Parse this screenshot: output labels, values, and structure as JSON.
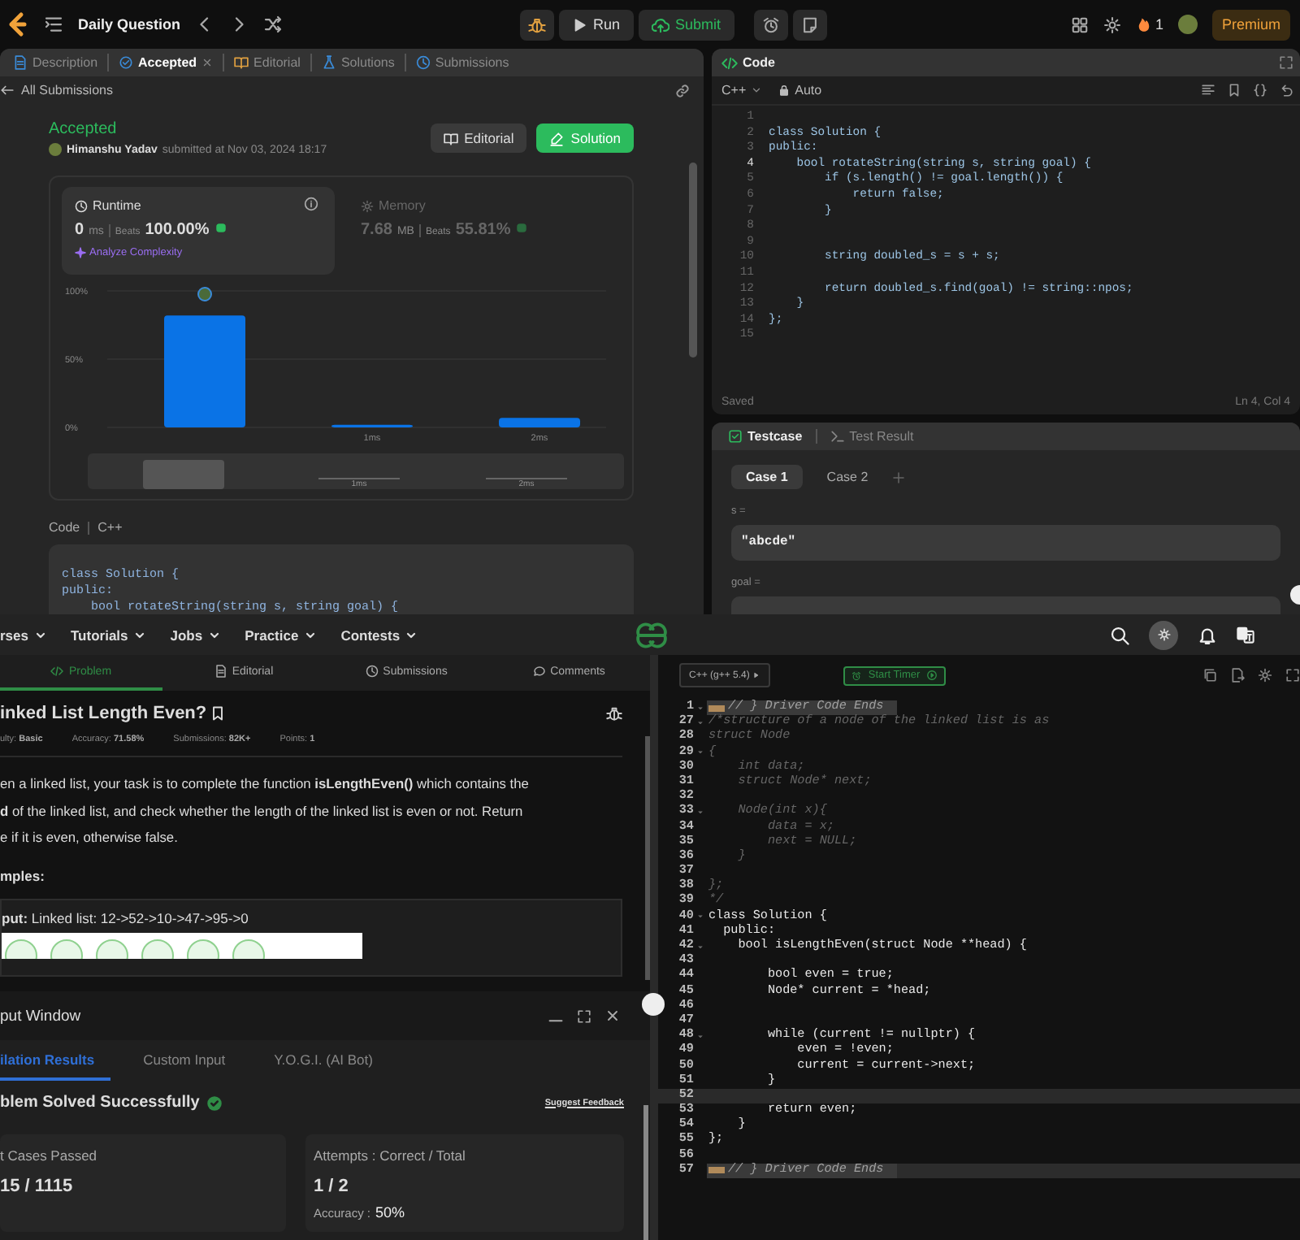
{
  "leetcode": {
    "topbar": {
      "title": "Daily Question",
      "run": "Run",
      "submit": "Submit",
      "streak": "1",
      "premium": "Premium"
    },
    "tabs": [
      {
        "label": "Description",
        "selected": false,
        "closable": false
      },
      {
        "label": "Accepted",
        "selected": true,
        "closable": true
      },
      {
        "label": "Editorial",
        "selected": false,
        "closable": false
      },
      {
        "label": "Solutions",
        "selected": false,
        "closable": false
      },
      {
        "label": "Submissions",
        "selected": false,
        "closable": false
      }
    ],
    "back_link": "All Submissions",
    "submission": {
      "status": "Accepted",
      "author": "Himanshu Yadav",
      "submitted": "submitted at Nov 03, 2024 18:17",
      "buttons": [
        {
          "label": "Editorial",
          "kind": "secondary"
        },
        {
          "label": "Solution",
          "kind": "primary"
        }
      ]
    },
    "stats": [
      {
        "title": "Runtime",
        "selected": true,
        "value": "0",
        "unit": "ms",
        "beats_label": "Beats",
        "beats": "100.00%",
        "link": "Analyze Complexity"
      },
      {
        "title": "Memory",
        "selected": false,
        "value": "7.68",
        "unit": "MB",
        "beats_label": "Beats",
        "beats": "55.81%"
      }
    ],
    "runtime_chart": {
      "chart_data": {
        "type": "bar",
        "categories": [
          null,
          "1ms",
          "2ms"
        ],
        "values": [
          82,
          2,
          7
        ],
        "ylim": [
          0,
          100
        ],
        "yticks": [
          {
            "value": 0,
            "label": "0%"
          },
          {
            "value": 50,
            "label": "50%"
          },
          {
            "value": 100,
            "label": "100%"
          }
        ]
      },
      "navigator_labels": [
        "1ms",
        "2ms"
      ]
    },
    "code_label": "Code",
    "code_language": "C++",
    "code_preview": [
      "class Solution {",
      "public:",
      "    bool rotateString(string s, string goal) {"
    ],
    "editor": {
      "title": "Code",
      "language": "C++",
      "mode": "Auto",
      "status": "Saved",
      "cursor": "Ln 4, Col 4",
      "lines": [
        {
          "number": "1",
          "current": false
        },
        {
          "number": "2",
          "code": "class Solution {",
          "current": false
        },
        {
          "number": "3",
          "code": "public:",
          "current": false
        },
        {
          "number": "4",
          "code": "    bool rotateString(string s, string goal) {",
          "current": true
        },
        {
          "number": "5",
          "code": "        if (s.length() != goal.length()) {",
          "current": false
        },
        {
          "number": "6",
          "code": "            return false;",
          "current": false
        },
        {
          "number": "7",
          "code": "        }",
          "current": false
        },
        {
          "number": "8",
          "current": false
        },
        {
          "number": "9",
          "current": false
        },
        {
          "number": "10",
          "code": "        string doubled_s = s + s;",
          "current": false
        },
        {
          "number": "11",
          "current": false
        },
        {
          "number": "12",
          "code": "        return doubled_s.find(goal) != string::npos;",
          "current": false
        },
        {
          "number": "13",
          "code": "    }",
          "current": false
        },
        {
          "number": "14",
          "code": "};",
          "current": false
        },
        {
          "number": "15",
          "current": false
        }
      ]
    },
    "testcase": {
      "tabs": [
        {
          "label": "Testcase",
          "selected": true
        },
        {
          "label": "Test Result",
          "selected": false
        }
      ],
      "cases": [
        {
          "label": "Case 1",
          "selected": true
        },
        {
          "label": "Case 2",
          "selected": false
        }
      ],
      "params": [
        {
          "name": "s =",
          "value": "\"abcde\""
        },
        {
          "name": "goal ="
        }
      ]
    }
  },
  "gfg": {
    "nav": [
      {
        "label": "rses"
      },
      {
        "label": "Tutorials"
      },
      {
        "label": "Jobs"
      },
      {
        "label": "Practice"
      },
      {
        "label": "Contests"
      }
    ],
    "tabs": [
      {
        "label": "Problem",
        "selected": true
      },
      {
        "label": "Editorial",
        "selected": false
      },
      {
        "label": "Submissions",
        "selected": false
      },
      {
        "label": "Comments",
        "selected": false
      }
    ],
    "problem": {
      "title": "inked List Length Even?",
      "meta": [
        "ulty: **Basic**",
        "Accuracy: **71.58%**",
        "Submissions: **82K+**",
        "Points: **1**"
      ],
      "description": "en a linked list, your task is to complete the function **isLengthEven()** which contains the\n**d** of the linked list, and check whether the length of the linked list is even or not. Return\ne if it is even, otherwise false.",
      "examples_heading": "mples:",
      "example": "**put:** Linked  list: 12->52->10->47->95->0"
    },
    "output": {
      "title": "put Window",
      "tabs": [
        {
          "label": "ilation Results",
          "selected": true
        },
        {
          "label": "Custom Input",
          "selected": false
        },
        {
          "label": "Y.O.G.I. (AI Bot)",
          "selected": false
        }
      ],
      "result": "blem Solved Successfully",
      "feedback": "Suggest Feedback",
      "cards": [
        {
          "title": "t Cases Passed",
          "value": "15 / 1115"
        },
        {
          "title": "Attempts : Correct / Total",
          "value": "1 / 2",
          "note_label": "Accuracy :",
          "note_value": "50%"
        }
      ]
    },
    "editor": {
      "language": "C++ (g++ 5.4)",
      "timer": "Start Timer",
      "lines": [
        {
          "number": "1",
          "kind": "folded",
          "code": "// } Driver Code Ends",
          "foldable": true,
          "current": false
        },
        {
          "number": "27",
          "kind": "comment",
          "code": "/*structure of a node of the linked list is as",
          "foldable": true,
          "current": false
        },
        {
          "number": "28",
          "kind": "comment",
          "code": "struct Node",
          "foldable": false,
          "current": false
        },
        {
          "number": "29",
          "kind": "comment",
          "code": "{",
          "foldable": true,
          "current": false
        },
        {
          "number": "30",
          "kind": "comment",
          "code": "    int data;",
          "foldable": false,
          "current": false
        },
        {
          "number": "31",
          "kind": "comment",
          "code": "    struct Node* next;",
          "foldable": false,
          "current": false
        },
        {
          "number": "32",
          "kind": "comment",
          "foldable": false,
          "current": false
        },
        {
          "number": "33",
          "kind": "comment",
          "code": "    Node(int x){",
          "foldable": true,
          "current": false
        },
        {
          "number": "34",
          "kind": "comment",
          "code": "        data = x;",
          "foldable": false,
          "current": false
        },
        {
          "number": "35",
          "kind": "comment",
          "code": "        next = NULL;",
          "foldable": false,
          "current": false
        },
        {
          "number": "36",
          "kind": "comment",
          "code": "    }",
          "foldable": false,
          "current": false
        },
        {
          "number": "37",
          "kind": "comment",
          "foldable": false,
          "current": false
        },
        {
          "number": "38",
          "kind": "comment",
          "code": "};",
          "foldable": false,
          "current": false
        },
        {
          "number": "39",
          "kind": "comment",
          "code": "*/",
          "foldable": false,
          "current": false
        },
        {
          "number": "40",
          "kind": "code",
          "code": "class Solution {",
          "foldable": true,
          "current": false
        },
        {
          "number": "41",
          "kind": "code",
          "code": "  public:",
          "foldable": false,
          "current": false
        },
        {
          "number": "42",
          "kind": "code",
          "code": "    bool isLengthEven(struct Node **head) {",
          "foldable": true,
          "current": false
        },
        {
          "number": "43",
          "kind": "code",
          "foldable": false,
          "current": false
        },
        {
          "number": "44",
          "kind": "code",
          "code": "        bool even = true;",
          "foldable": false,
          "current": false
        },
        {
          "number": "45",
          "kind": "code",
          "code": "        Node* current = *head;",
          "foldable": false,
          "current": false
        },
        {
          "number": "46",
          "kind": "code",
          "foldable": false,
          "current": false
        },
        {
          "number": "47",
          "kind": "code",
          "foldable": false,
          "current": false
        },
        {
          "number": "48",
          "kind": "code",
          "code": "        while (current != nullptr) {",
          "foldable": true,
          "current": false
        },
        {
          "number": "49",
          "kind": "code",
          "code": "            even = !even;",
          "foldable": false,
          "current": false
        },
        {
          "number": "50",
          "kind": "code",
          "code": "            current = current->next;",
          "foldable": false,
          "current": false
        },
        {
          "number": "51",
          "kind": "code",
          "code": "        }",
          "foldable": false,
          "current": false
        },
        {
          "number": "52",
          "kind": "code",
          "foldable": false,
          "current": true
        },
        {
          "number": "53",
          "kind": "code",
          "code": "        return even;",
          "foldable": false,
          "current": false
        },
        {
          "number": "54",
          "kind": "code",
          "code": "    }",
          "foldable": false,
          "current": false
        },
        {
          "number": "55",
          "kind": "code",
          "code": "};",
          "foldable": false,
          "current": false
        },
        {
          "number": "56",
          "kind": "code",
          "foldable": false,
          "current": false
        },
        {
          "number": "57",
          "kind": "folded",
          "code": "// } Driver Code Ends",
          "foldable": false,
          "current": false
        }
      ]
    }
  }
}
